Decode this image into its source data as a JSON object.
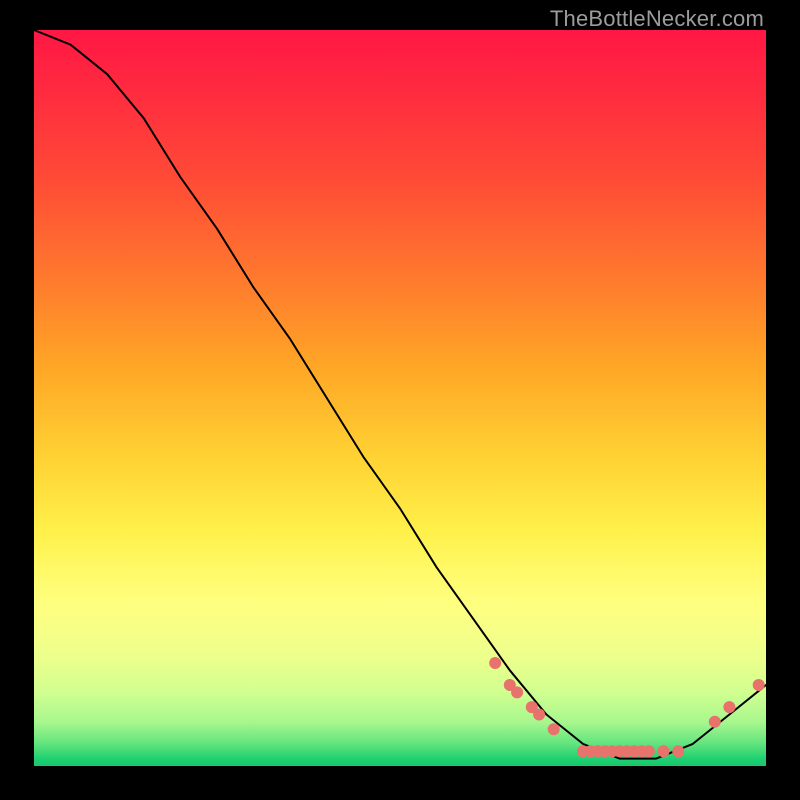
{
  "watermark": "TheBottleNecker.com",
  "chart_data": {
    "type": "line",
    "title": "",
    "xlabel": "",
    "ylabel": "",
    "xlim": [
      0,
      100
    ],
    "ylim": [
      0,
      100
    ],
    "background_gradient": {
      "top_color": "#ff1744",
      "mid_colors": [
        "#ffa726",
        "#fff04a"
      ],
      "bottom_color": "#15c96b",
      "meaning": "red (high bottleneck) → green (low bottleneck)"
    },
    "series": [
      {
        "name": "bottleneck-curve",
        "x": [
          0,
          5,
          10,
          15,
          20,
          25,
          30,
          35,
          40,
          45,
          50,
          55,
          60,
          65,
          70,
          75,
          80,
          85,
          90,
          95,
          100
        ],
        "y": [
          100,
          98,
          94,
          88,
          80,
          73,
          65,
          58,
          50,
          42,
          35,
          27,
          20,
          13,
          7,
          3,
          1,
          1,
          3,
          7,
          11
        ],
        "color": "#000000",
        "stroke_width": 2
      }
    ],
    "markers": {
      "name": "highlighted-points",
      "color": "#e8726c",
      "radius": 6,
      "points": [
        {
          "x": 63,
          "y": 14
        },
        {
          "x": 65,
          "y": 11
        },
        {
          "x": 66,
          "y": 10
        },
        {
          "x": 68,
          "y": 8
        },
        {
          "x": 69,
          "y": 7
        },
        {
          "x": 71,
          "y": 5
        },
        {
          "x": 75,
          "y": 2
        },
        {
          "x": 76,
          "y": 2
        },
        {
          "x": 77,
          "y": 2
        },
        {
          "x": 78,
          "y": 2
        },
        {
          "x": 79,
          "y": 2
        },
        {
          "x": 80,
          "y": 2
        },
        {
          "x": 81,
          "y": 2
        },
        {
          "x": 82,
          "y": 2
        },
        {
          "x": 83,
          "y": 2
        },
        {
          "x": 84,
          "y": 2
        },
        {
          "x": 86,
          "y": 2
        },
        {
          "x": 88,
          "y": 2
        },
        {
          "x": 93,
          "y": 6
        },
        {
          "x": 95,
          "y": 8
        },
        {
          "x": 99,
          "y": 11
        }
      ]
    }
  }
}
